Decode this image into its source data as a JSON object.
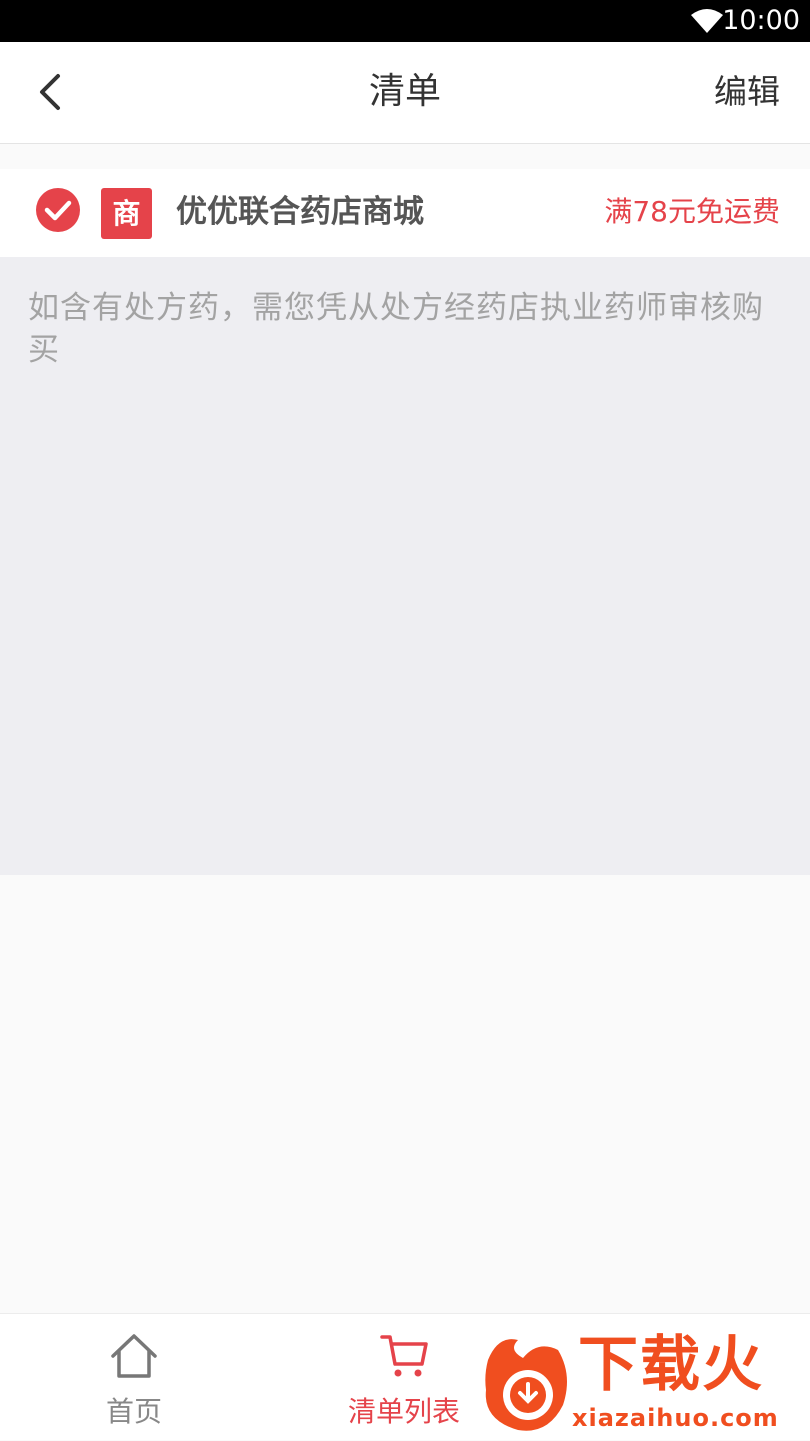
{
  "status_bar": {
    "time": "10:00"
  },
  "header": {
    "title": "清单",
    "edit_label": "编辑"
  },
  "store": {
    "badge": "商",
    "name": "优优联合药店商城",
    "shipping_note": "满78元免运费",
    "selected": true
  },
  "notice": "如含有处方药，需您凭从处方经药店执业药师审核购买",
  "tabbar": {
    "items": [
      {
        "label": "首页",
        "icon": "home-icon",
        "active": false
      },
      {
        "label": "清单列表",
        "icon": "cart-icon",
        "active": true
      }
    ]
  },
  "watermark": {
    "text": "下载火",
    "url": "xiazaihuo.com"
  },
  "colors": {
    "accent": "#e5434a",
    "notice_bg": "#eeeef2",
    "watermark": "#f04e1f"
  }
}
